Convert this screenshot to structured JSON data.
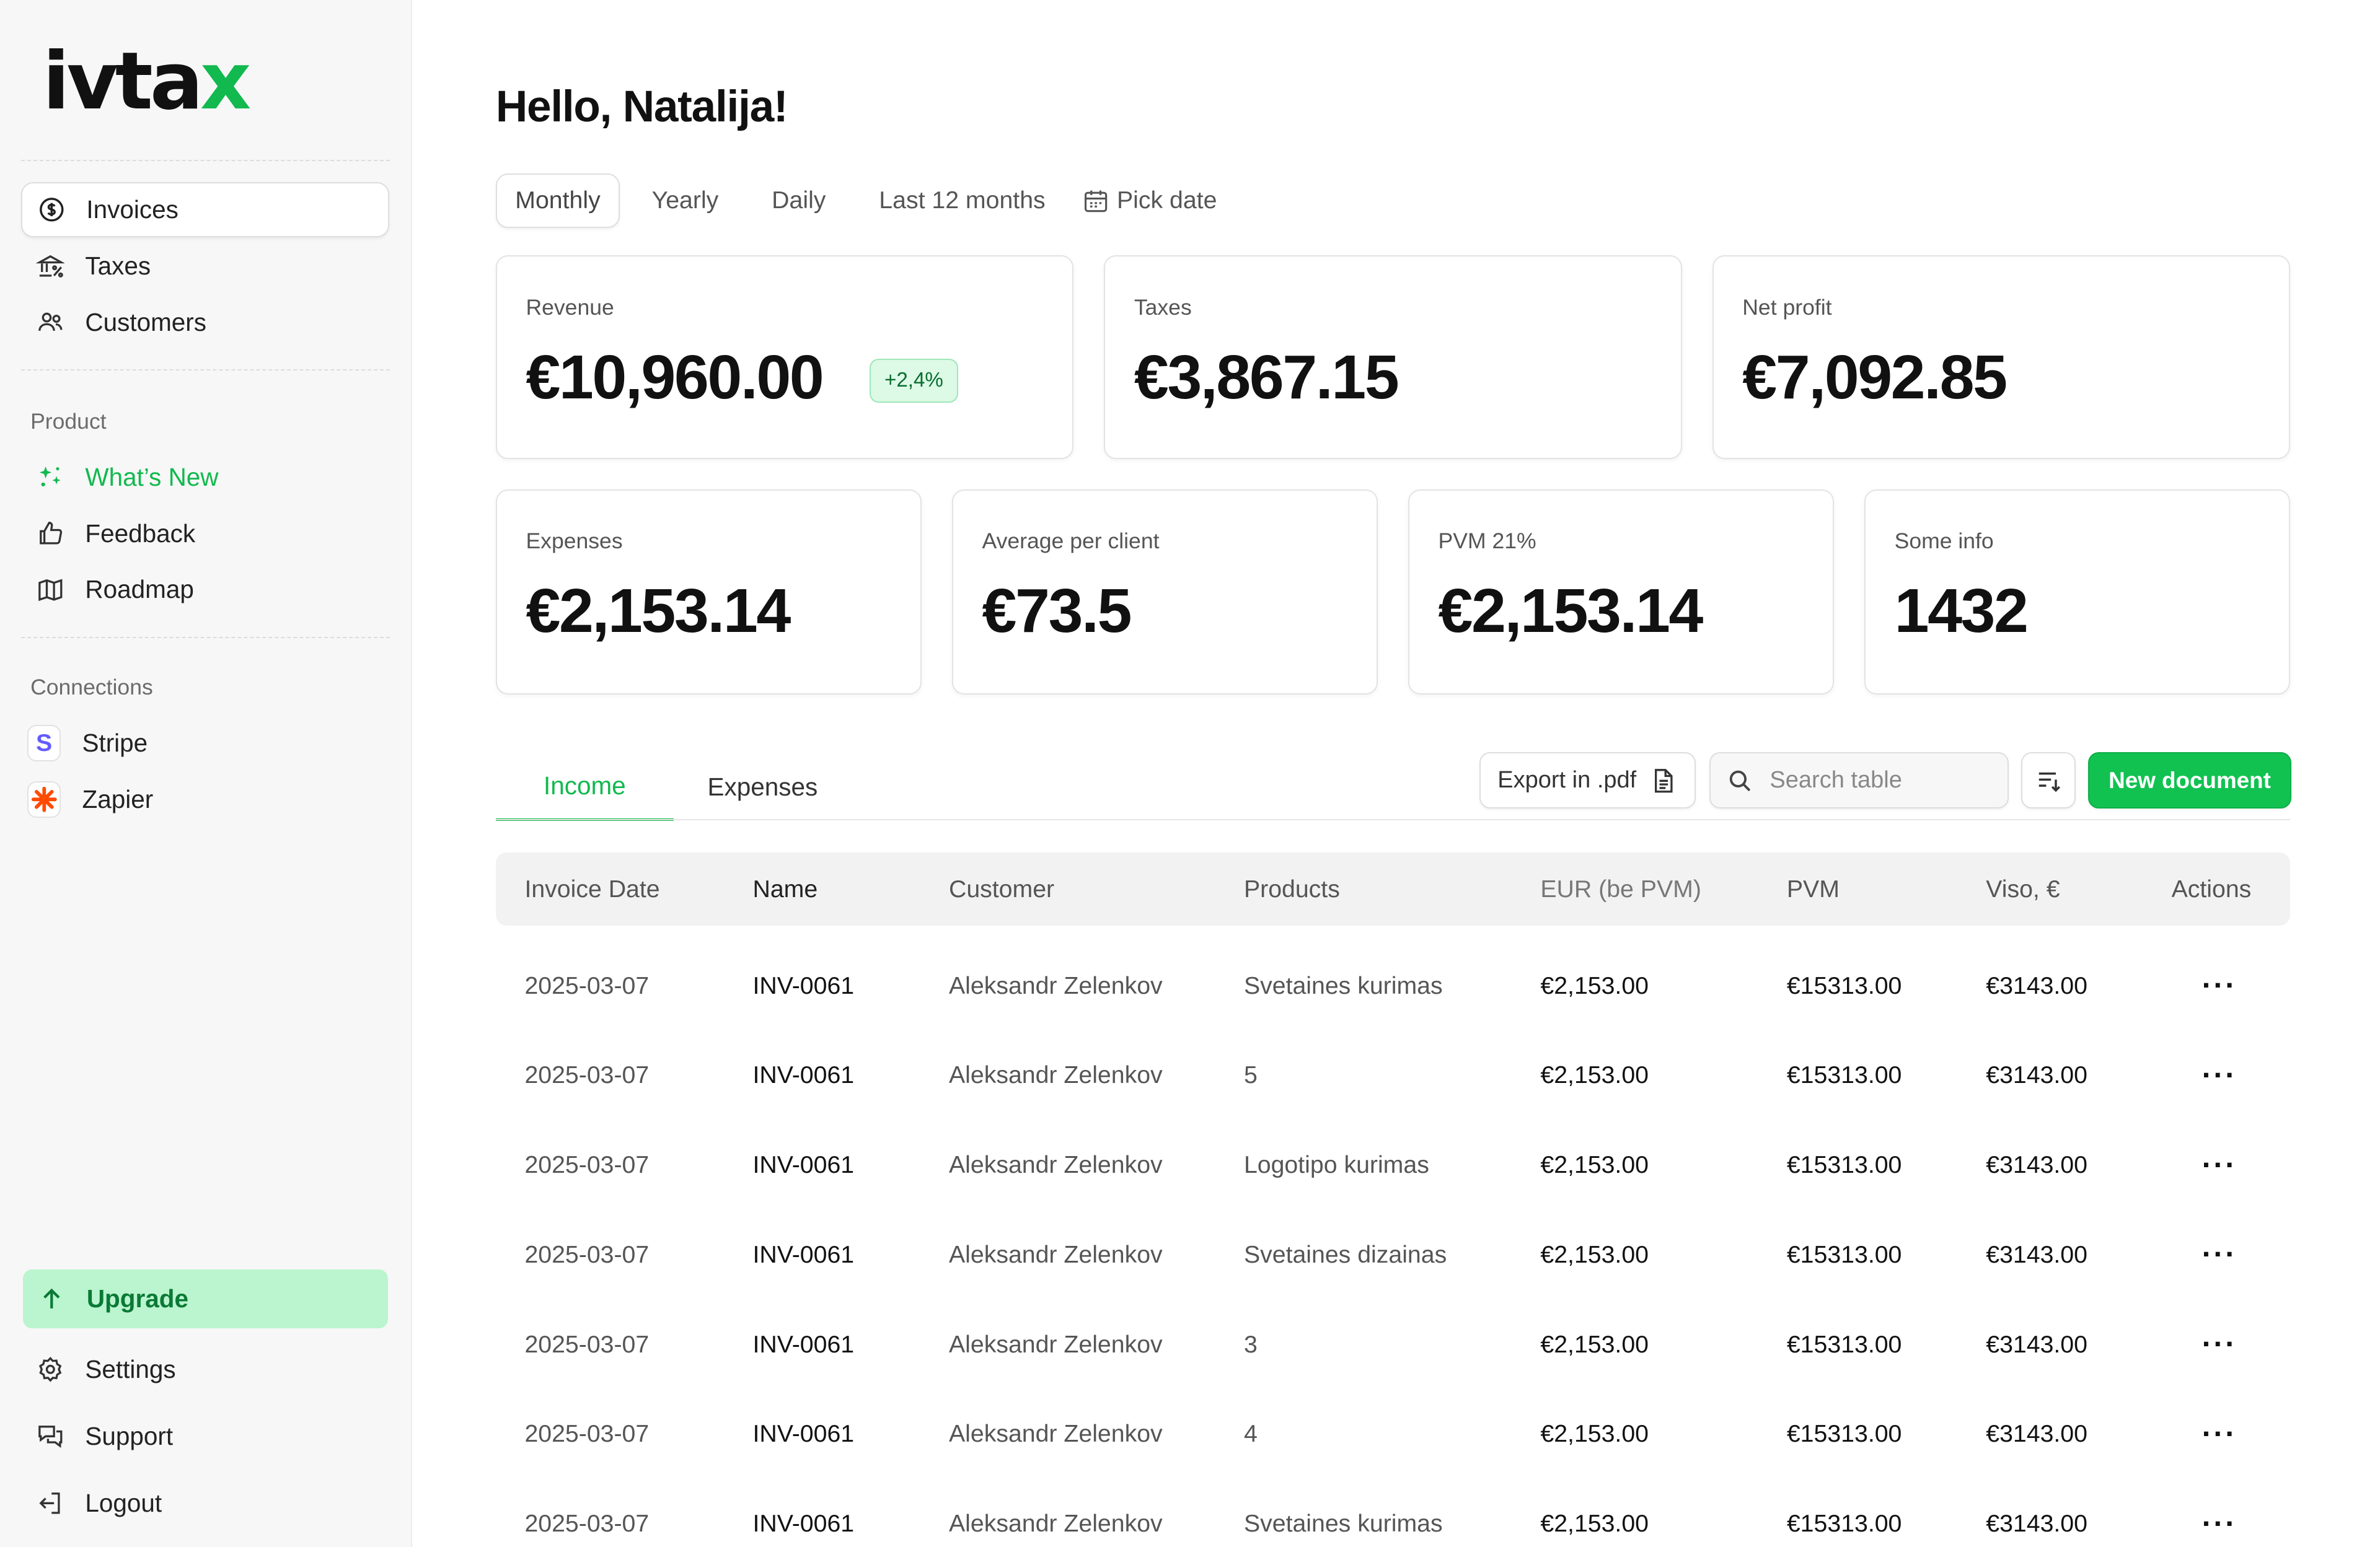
{
  "brand": {
    "logo_main": "ivta",
    "logo_accent": "x",
    "accent_color": "#11b94e"
  },
  "sidebar": {
    "main_items": [
      {
        "label": "Invoices",
        "icon": "dollar-circle-icon",
        "active": true
      },
      {
        "label": "Taxes",
        "icon": "bank-percent-icon"
      },
      {
        "label": "Customers",
        "icon": "users-icon"
      }
    ],
    "product_label": "Product",
    "product_items": [
      {
        "label": "What’s New",
        "icon": "sparkles-icon"
      },
      {
        "label": "Feedback",
        "icon": "thumbs-up-icon"
      },
      {
        "label": "Roadmap",
        "icon": "map-icon"
      }
    ],
    "connections_label": "Connections",
    "connection_items": [
      {
        "label": "Stripe",
        "icon": "stripe-icon",
        "glyph": "S"
      },
      {
        "label": "Zapier",
        "icon": "zapier-icon"
      }
    ],
    "upgrade_label": "Upgrade",
    "bottom_items": [
      {
        "label": "Settings",
        "icon": "gear-icon"
      },
      {
        "label": "Support",
        "icon": "chat-bubbles-icon"
      },
      {
        "label": "Logout",
        "icon": "logout-icon"
      }
    ]
  },
  "main": {
    "greeting": "Hello, Natalija!",
    "period_tabs": [
      "Monthly",
      "Yearly",
      "Daily",
      "Last 12 months",
      "Pick date"
    ],
    "active_period": "Monthly",
    "stats_top": [
      {
        "label": "Revenue",
        "value": "€10,960.00",
        "delta": "+2,4%"
      },
      {
        "label": "Taxes",
        "value": "€3,867.15"
      },
      {
        "label": "Net profit",
        "value": "€7,092.85"
      }
    ],
    "stats_bottom": [
      {
        "label": "Expenses",
        "value": "€2,153.14"
      },
      {
        "label": "Average per client",
        "value": "€73.5"
      },
      {
        "label": "PVM 21%",
        "value": "€2,153.14"
      },
      {
        "label": "Some info",
        "value": "1432"
      }
    ],
    "doc_tabs": [
      "Income",
      "Expenses"
    ],
    "active_doc_tab": "Income",
    "export_label": "Export in .pdf",
    "search_placeholder": "Search table",
    "new_document_label": "New document",
    "table": {
      "columns": [
        "Invoice Date",
        "Name",
        "Customer",
        "Products",
        "EUR (be PVM)",
        "PVM",
        "Viso, €",
        "Actions"
      ],
      "rows": [
        [
          "2025-03-07",
          "INV-0061",
          "Aleksandr Zelenkov",
          "Svetaines kurimas",
          "€2,153.00",
          "€15313.00",
          "€3143.00",
          "···"
        ],
        [
          "2025-03-07",
          "INV-0061",
          "Aleksandr Zelenkov",
          "5",
          "€2,153.00",
          "€15313.00",
          "€3143.00",
          "···"
        ],
        [
          "2025-03-07",
          "INV-0061",
          "Aleksandr Zelenkov",
          "Logotipo kurimas",
          "€2,153.00",
          "€15313.00",
          "€3143.00",
          "···"
        ],
        [
          "2025-03-07",
          "INV-0061",
          "Aleksandr Zelenkov",
          "Svetaines dizainas",
          "€2,153.00",
          "€15313.00",
          "€3143.00",
          "···"
        ],
        [
          "2025-03-07",
          "INV-0061",
          "Aleksandr Zelenkov",
          "3",
          "€2,153.00",
          "€15313.00",
          "€3143.00",
          "···"
        ],
        [
          "2025-03-07",
          "INV-0061",
          "Aleksandr Zelenkov",
          "4",
          "€2,153.00",
          "€15313.00",
          "€3143.00",
          "···"
        ],
        [
          "2025-03-07",
          "INV-0061",
          "Aleksandr Zelenkov",
          "Svetaines kurimas",
          "€2,153.00",
          "€15313.00",
          "€3143.00",
          "···"
        ]
      ]
    }
  }
}
